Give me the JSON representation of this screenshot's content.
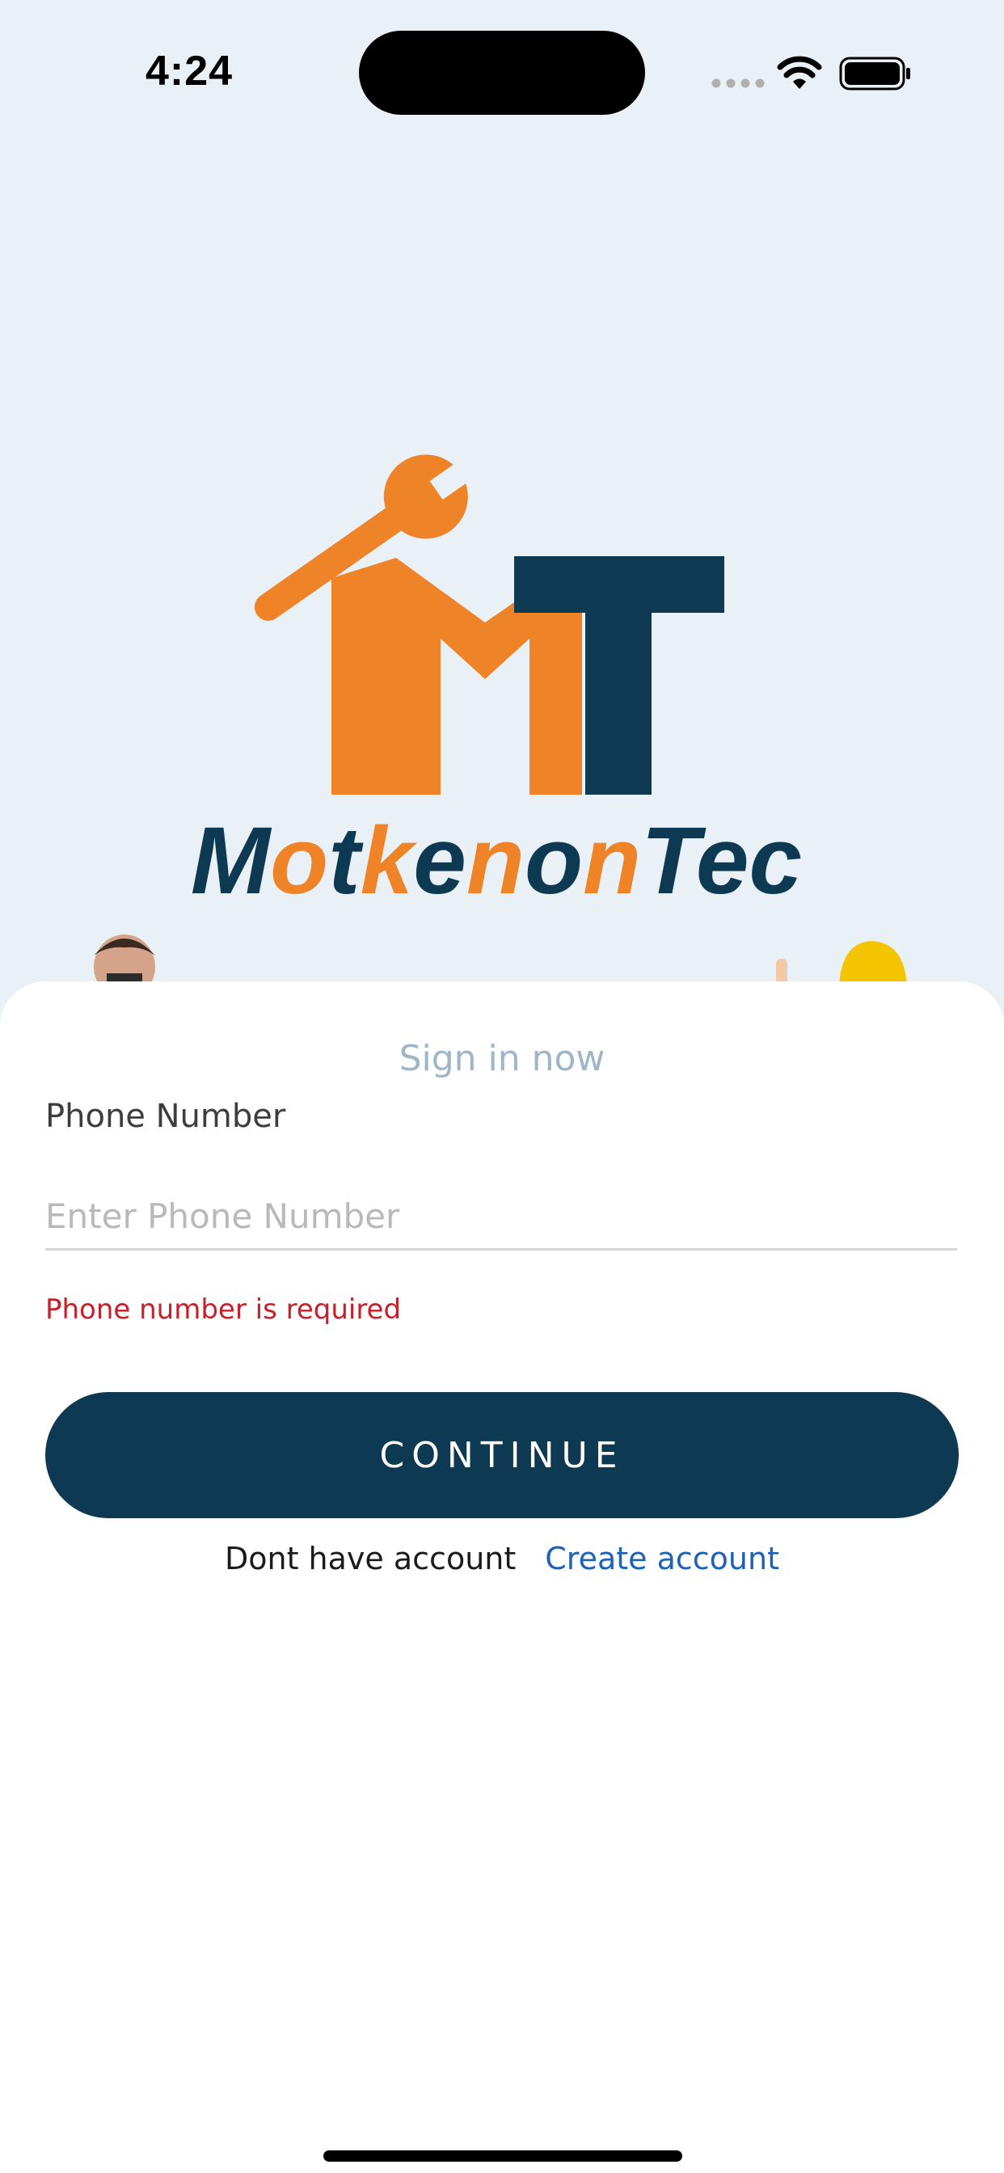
{
  "status_bar": {
    "time": "4:24",
    "icons": [
      "cellular-signal-icon",
      "wifi-icon",
      "battery-icon"
    ]
  },
  "brand": {
    "name": "MotkenonTec",
    "logo_letters": [
      "M",
      "T"
    ],
    "colors": {
      "orange": "#ee8328",
      "navy": "#0d3a52"
    }
  },
  "sign_in": {
    "title": "Sign in now",
    "phone_label": "Phone Number",
    "phone_placeholder": "Enter Phone Number",
    "phone_value": "",
    "error": "Phone number is required",
    "continue_label": "CONTINUE",
    "signup_prompt": "Dont have account",
    "create_account": "Create account"
  },
  "colors": {
    "background": "#e9f0f6",
    "error": "#c8202a",
    "link": "#1e62b4",
    "button": "#0d3a52"
  }
}
